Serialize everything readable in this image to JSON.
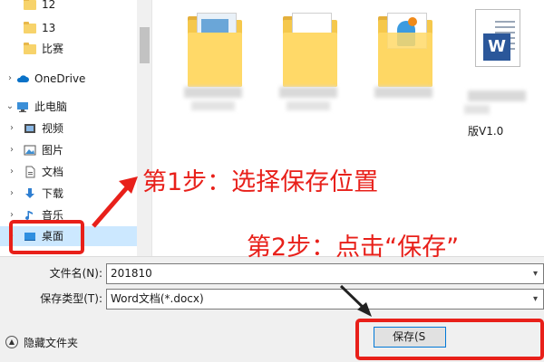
{
  "nav": {
    "items": [
      {
        "label": "12",
        "icon": "folder-icon",
        "arrow": ""
      },
      {
        "label": "13",
        "icon": "folder-icon",
        "arrow": ""
      },
      {
        "label": "比赛",
        "icon": "folder-icon",
        "arrow": ""
      },
      {
        "label": "OneDrive",
        "icon": "cloud-icon",
        "arrow": "›"
      },
      {
        "label": "此电脑",
        "icon": "computer-icon",
        "arrow": "⌄"
      },
      {
        "label": "视频",
        "icon": "video-icon",
        "arrow": "›"
      },
      {
        "label": "图片",
        "icon": "picture-icon",
        "arrow": "›"
      },
      {
        "label": "文档",
        "icon": "document-icon",
        "arrow": "›"
      },
      {
        "label": "下载",
        "icon": "download-icon",
        "arrow": "›"
      },
      {
        "label": "音乐",
        "icon": "music-icon",
        "arrow": "›"
      },
      {
        "label": "桌面",
        "icon": "desktop-icon",
        "arrow": "›",
        "selected": true
      }
    ]
  },
  "files": [
    {
      "name": "",
      "icon": "folder-with-document-icon"
    },
    {
      "name": "",
      "icon": "folder-icon"
    },
    {
      "name": "",
      "icon": "folder-with-image-icon"
    },
    {
      "name": "版V1.0",
      "icon": "word-document-icon"
    }
  ],
  "form": {
    "filename_label": "文件名(N):",
    "filename_value": "201810",
    "filetype_label": "保存类型(T):",
    "filetype_value": "Word文档(*.docx)",
    "hide_folders_label": "隐藏文件夹",
    "save_label": "保存(S"
  },
  "annotations": {
    "step1": "第1步：选择保存位置",
    "step2": "第2步：点击“保存”"
  },
  "colors": {
    "annotation": "#e8201a",
    "selection": "#cce8ff",
    "folder": "#f5c84c",
    "word": "#2b579a"
  }
}
